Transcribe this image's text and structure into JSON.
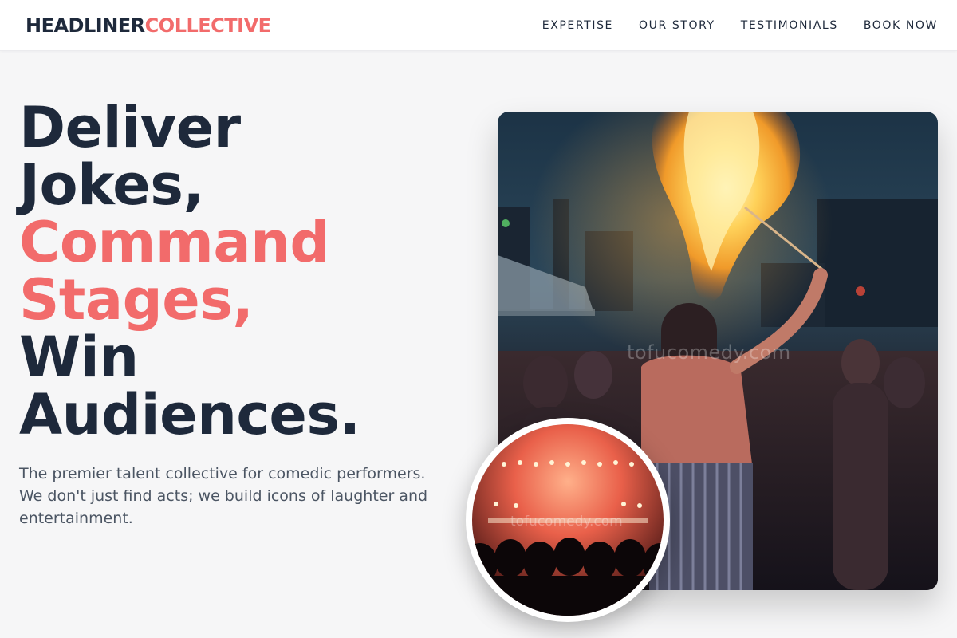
{
  "header": {
    "logo_part1": "HEADLINER",
    "logo_part2": "COLLECTIVE",
    "nav": [
      {
        "label": "EXPERTISE"
      },
      {
        "label": "OUR STORY"
      },
      {
        "label": "TESTIMONIALS"
      },
      {
        "label": "BOOK NOW"
      }
    ]
  },
  "hero": {
    "headline_lines": [
      {
        "text": "Deliver",
        "accent": false
      },
      {
        "text": "Jokes,",
        "accent": false
      },
      {
        "text": "Command",
        "accent": true
      },
      {
        "text": "Stages,",
        "accent": true
      },
      {
        "text": "Win",
        "accent": false
      },
      {
        "text": "Audiences.",
        "accent": false
      }
    ],
    "subtext": "The premier talent collective for comedic performers. We don't just find acts; we build icons of laughter and entertainment."
  },
  "images": {
    "main_photo_watermark": "tofucomedy.com",
    "circle_photo_watermark": "tofucomedy.com"
  },
  "colors": {
    "accent": "#f26b6b",
    "text_dark": "#1e293b",
    "text_muted": "#4b5563",
    "background": "#f6f6f7"
  }
}
